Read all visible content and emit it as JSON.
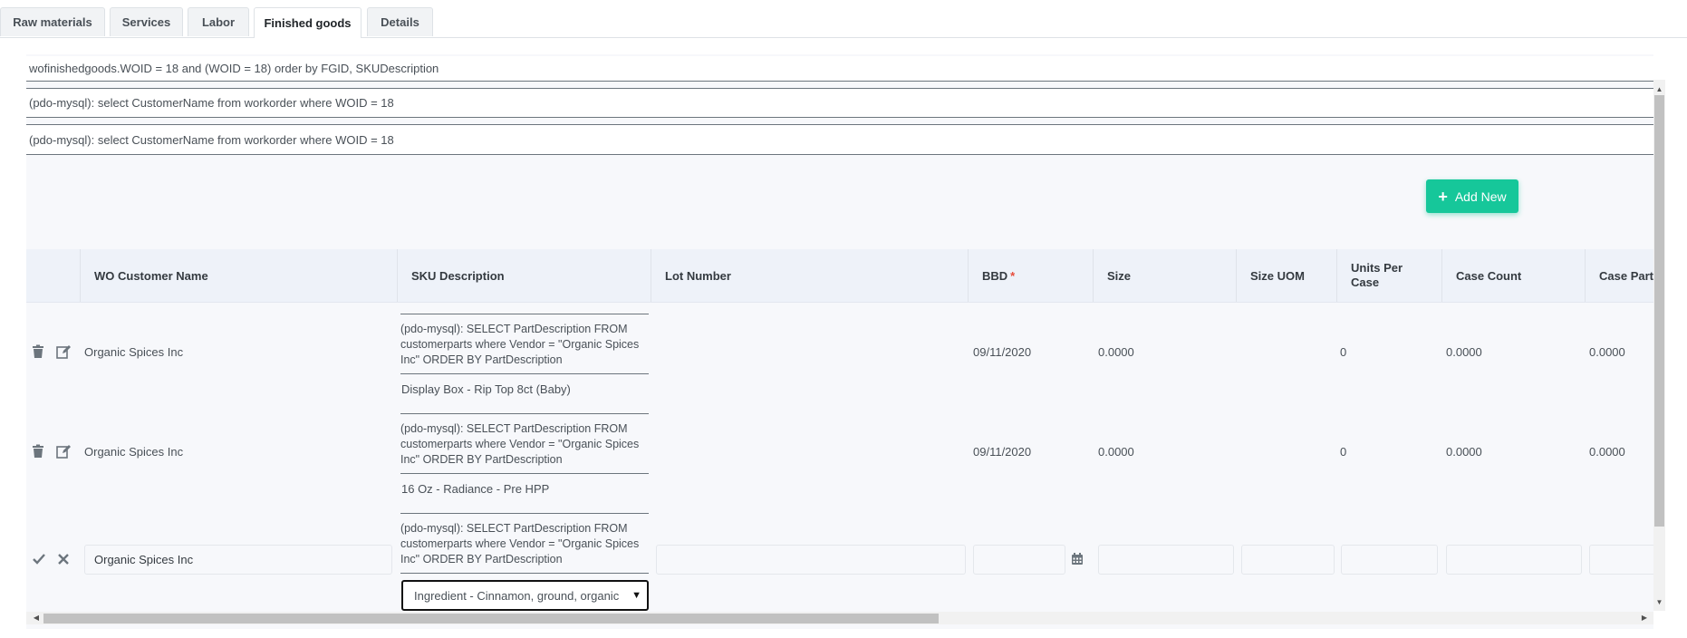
{
  "tabs": [
    {
      "label": "Raw materials"
    },
    {
      "label": "Services"
    },
    {
      "label": "Labor"
    },
    {
      "label": "Finished goods",
      "active": true
    },
    {
      "label": "Details"
    }
  ],
  "debug_lines": [
    "wofinishedgoods.WOID = 18 and (WOID = 18) order by FGID, SKUDescription",
    "(pdo-mysql): select CustomerName from workorder where WOID = 18",
    "(pdo-mysql): select CustomerName from workorder where WOID = 18"
  ],
  "add_button": {
    "label": "Add New"
  },
  "columns": {
    "wo_customer_name": "WO Customer Name",
    "sku_description": "SKU Description",
    "lot_number": "Lot Number",
    "bbd": "BBD",
    "bbd_required_mark": "*",
    "size": "Size",
    "size_uom": "Size UOM",
    "units_per_case": "Units Per Case",
    "case_count": "Case Count",
    "case_part": "Case Part"
  },
  "rows": [
    {
      "customer": "Organic Spices Inc",
      "sku_debug": "(pdo-mysql): SELECT PartDescription FROM customerparts where Vendor = \"Organic Spices Inc\" ORDER BY PartDescription",
      "sku": "Display Box - Rip Top 8ct (Baby)",
      "bbd": "09/11/2020",
      "size": "0.0000",
      "units_per_case": "0",
      "case_count": "0.0000",
      "case_part": "0.0000"
    },
    {
      "customer": "Organic Spices Inc",
      "sku_debug": "(pdo-mysql): SELECT PartDescription FROM customerparts where Vendor = \"Organic Spices Inc\" ORDER BY PartDescription",
      "sku": "16 Oz - Radiance - Pre HPP",
      "bbd": "09/11/2020",
      "size": "0.0000",
      "units_per_case": "0",
      "case_count": "0.0000",
      "case_part": "0.0000"
    }
  ],
  "edit_row": {
    "customer": "Organic Spices Inc",
    "sku_debug": "(pdo-mysql): SELECT PartDescription FROM customerparts where Vendor = \"Organic Spices Inc\" ORDER BY PartDescription",
    "sku_selected": "Ingredient - Cinnamon, ground, organic"
  },
  "icons": {
    "delete": "trash-icon",
    "edit": "edit-icon",
    "save": "check-icon",
    "cancel": "close-icon",
    "calendar": "calendar-icon",
    "add": "plus-icon"
  },
  "colors": {
    "accent": "#16c79a",
    "header_bg": "#eef2f9",
    "required": "#e74c3c"
  }
}
